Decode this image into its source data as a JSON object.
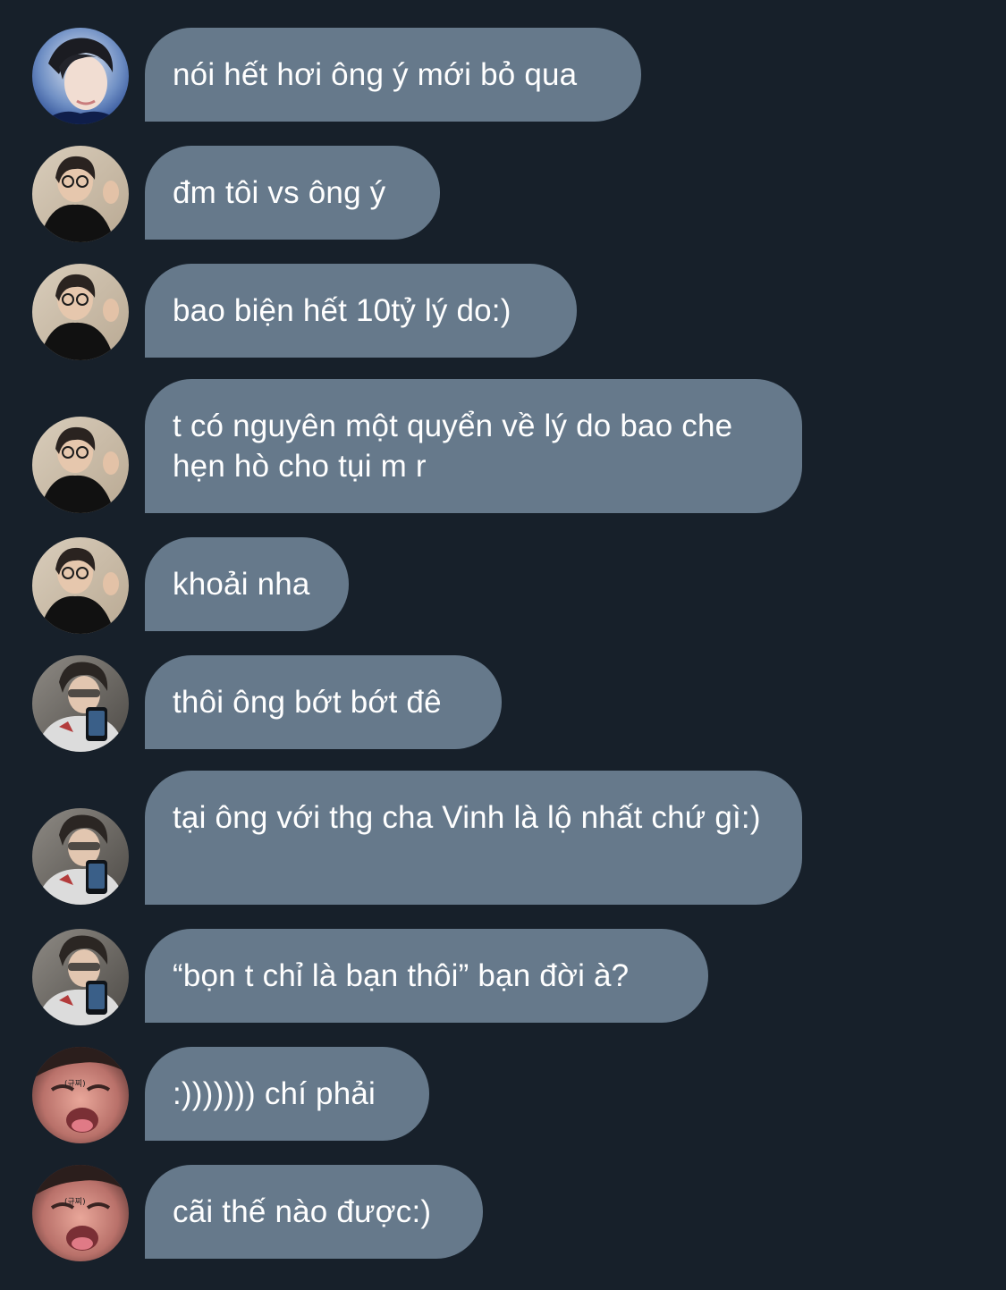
{
  "colors": {
    "background": "#17202a",
    "bubble": "#66798b",
    "text": "#ffffff"
  },
  "messages": [
    {
      "sender": "avatar-1",
      "text": "nói hết hơi ông ý mới bỏ qua"
    },
    {
      "sender": "avatar-2",
      "text": "đm tôi vs ông ý"
    },
    {
      "sender": "avatar-2",
      "text": "bao biện hết 10tỷ lý do:)"
    },
    {
      "sender": "avatar-2",
      "text": "t có nguyên một quyển về lý do bao che hẹn hò cho tụi m r"
    },
    {
      "sender": "avatar-2",
      "text": "khoải nha"
    },
    {
      "sender": "avatar-3",
      "text": "thôi ông bớt bớt đê"
    },
    {
      "sender": "avatar-3",
      "text": "tại ông với thg cha Vinh là lộ nhất chứ gì:)"
    },
    {
      "sender": "avatar-3",
      "text": "“bọn t chỉ là bạn thôi” bạn đời à?"
    },
    {
      "sender": "avatar-4",
      "text": ":))))))) chí phải",
      "avatar_caption": "(규찌)"
    },
    {
      "sender": "avatar-4",
      "text": "cãi thế nào được:)",
      "avatar_caption": "(규찌)"
    }
  ]
}
